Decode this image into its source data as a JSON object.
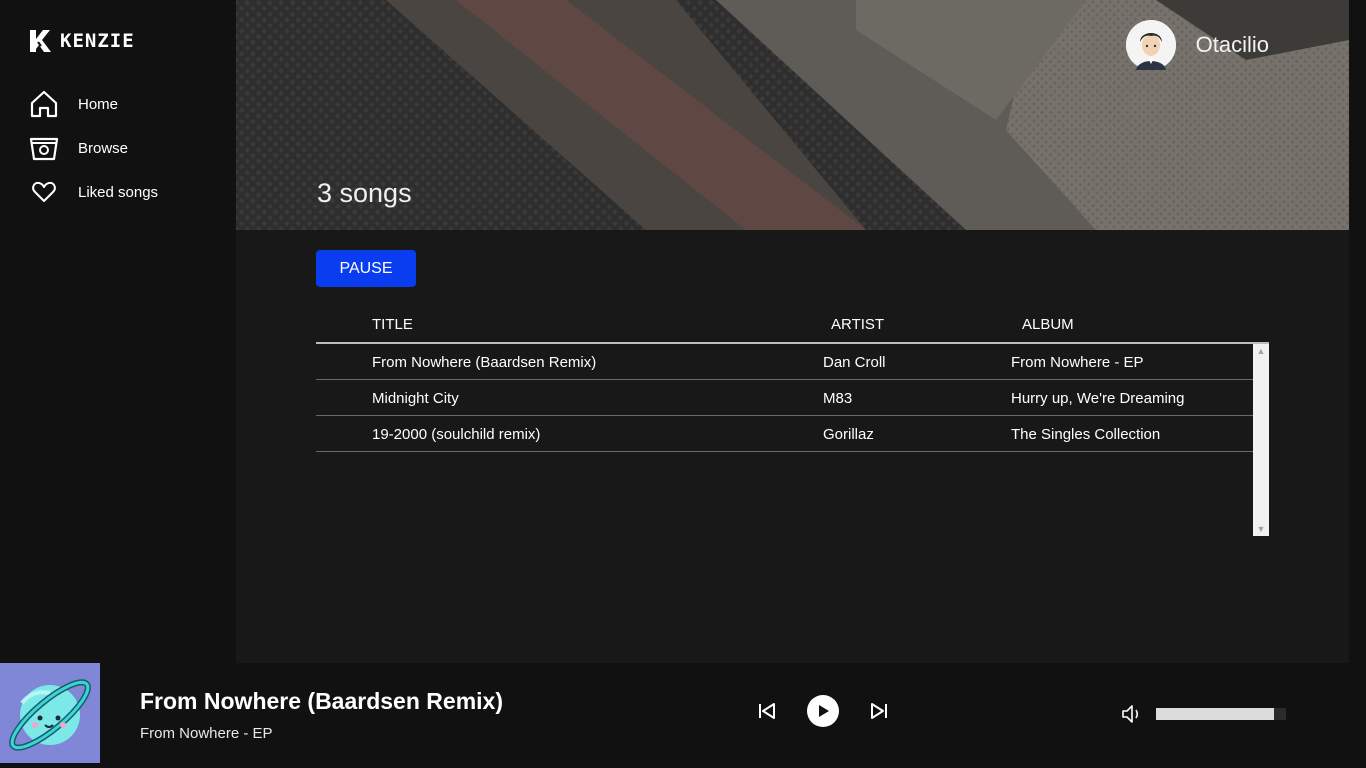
{
  "brand": {
    "name": "KENZIE"
  },
  "sidebar": {
    "items": [
      {
        "label": "Home",
        "icon": "home-icon"
      },
      {
        "label": "Browse",
        "icon": "browse-icon"
      },
      {
        "label": "Liked songs",
        "icon": "heart-icon"
      }
    ]
  },
  "header": {
    "song_count": "3 songs",
    "user_name": "Otacilio"
  },
  "actions": {
    "pause_label": "PAUSE"
  },
  "table": {
    "columns": {
      "title": "TITLE",
      "artist": "ARTIST",
      "album": "ALBUM"
    },
    "rows": [
      {
        "title": "From Nowhere (Baardsen Remix)",
        "artist": "Dan Croll",
        "album": "From Nowhere - EP"
      },
      {
        "title": "Midnight City",
        "artist": "M83",
        "album": "Hurry up, We're Dreaming"
      },
      {
        "title": "19-2000 (soulchild remix)",
        "artist": "Gorillaz",
        "album": "The Singles Collection"
      }
    ]
  },
  "player": {
    "title": "From Nowhere (Baardsen Remix)",
    "album": "From Nowhere - EP",
    "volume_fraction": 0.91
  },
  "colors": {
    "accent": "#0a3cf0",
    "background": "#181818",
    "sidebar": "#111111"
  }
}
